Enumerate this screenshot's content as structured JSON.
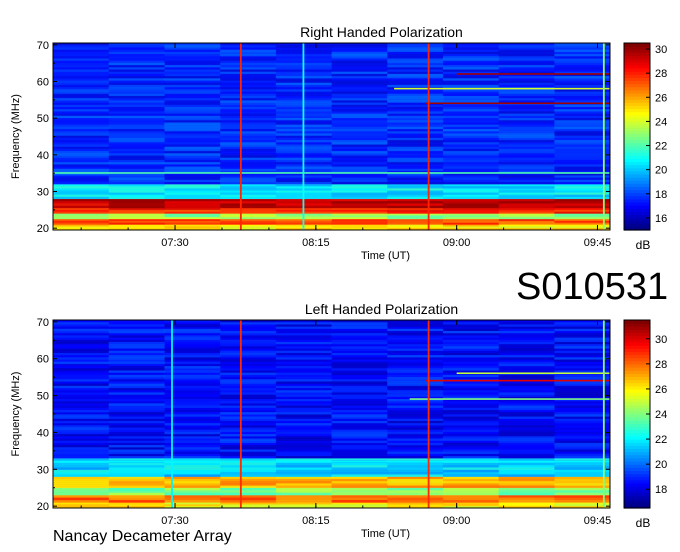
{
  "figure_id": "S010531",
  "footer": "Nancay Decameter Array",
  "chart_data": [
    {
      "type": "heatmap",
      "title": "Right Handed Polarization",
      "xlabel": "Time (UT)",
      "ylabel": "Frequency (MHz)",
      "x_ticks": [
        "07:30",
        "08:15",
        "09:00",
        "09:45"
      ],
      "x_tick_values_min": [
        450,
        495,
        540,
        585
      ],
      "xlim_min": [
        411,
        589
      ],
      "y_ticks": [
        20,
        30,
        40,
        50,
        60,
        70
      ],
      "ylim": [
        19.5,
        70.5
      ],
      "colorbar": {
        "label": "dB",
        "ticks": [
          16,
          18,
          20,
          22,
          24,
          26,
          28,
          30
        ],
        "range": [
          15,
          30.5
        ]
      },
      "bands": [
        {
          "f0": 19.5,
          "f1": 21,
          "db": 25
        },
        {
          "f0": 21,
          "f1": 22.5,
          "db": 27.5
        },
        {
          "f0": 22.5,
          "f1": 24,
          "db": 23
        },
        {
          "f0": 24,
          "f1": 25.5,
          "db": 28
        },
        {
          "f0": 25.5,
          "f1": 28,
          "db": 29.5
        },
        {
          "f0": 28,
          "f1": 32,
          "db": 20.5
        },
        {
          "f0": 32,
          "f1": 70.5,
          "db": 17.5
        }
      ],
      "lines": [
        {
          "f": 54,
          "t0": 530,
          "t1": 589,
          "db": 30
        },
        {
          "f": 58,
          "t0": 520,
          "t1": 589,
          "db": 24
        },
        {
          "f": 62,
          "t0": 540,
          "t1": 589,
          "db": 30
        },
        {
          "f": 35,
          "t0": 411,
          "t1": 589,
          "db": 22
        }
      ],
      "vertical_lines_min": [
        {
          "t": 471,
          "db": 28
        },
        {
          "t": 531,
          "db": 28
        },
        {
          "t": 587,
          "db": 23
        },
        {
          "t": 491,
          "db": 21
        }
      ]
    },
    {
      "type": "heatmap",
      "title": "Left Handed Polarization",
      "xlabel": "Time (UT)",
      "ylabel": "Frequency (MHz)",
      "x_ticks": [
        "07:30",
        "08:15",
        "09:00",
        "09:45"
      ],
      "x_tick_values_min": [
        450,
        495,
        540,
        585
      ],
      "xlim_min": [
        411,
        589
      ],
      "y_ticks": [
        20,
        30,
        40,
        50,
        60,
        70
      ],
      "ylim": [
        19.5,
        70.5
      ],
      "colorbar": {
        "label": "dB",
        "ticks": [
          18,
          20,
          22,
          24,
          26,
          28,
          30
        ],
        "range": [
          16.5,
          31.5
        ]
      },
      "bands": [
        {
          "f0": 19.5,
          "f1": 21,
          "db": 26
        },
        {
          "f0": 21,
          "f1": 23,
          "db": 28
        },
        {
          "f0": 23,
          "f1": 25,
          "db": 24
        },
        {
          "f0": 25,
          "f1": 28,
          "db": 27
        },
        {
          "f0": 28,
          "f1": 33,
          "db": 21.5
        },
        {
          "f0": 33,
          "f1": 70.5,
          "db": 18.5
        }
      ],
      "lines": [
        {
          "f": 54,
          "t0": 530,
          "t1": 589,
          "db": 30
        },
        {
          "f": 56,
          "t0": 540,
          "t1": 589,
          "db": 25
        },
        {
          "f": 49,
          "t0": 525,
          "t1": 589,
          "db": 24
        },
        {
          "f": 32,
          "t0": 411,
          "t1": 589,
          "db": 22
        }
      ],
      "vertical_lines_min": [
        {
          "t": 471,
          "db": 29
        },
        {
          "t": 531,
          "db": 29
        },
        {
          "t": 587,
          "db": 24
        },
        {
          "t": 449,
          "db": 22
        }
      ]
    }
  ]
}
